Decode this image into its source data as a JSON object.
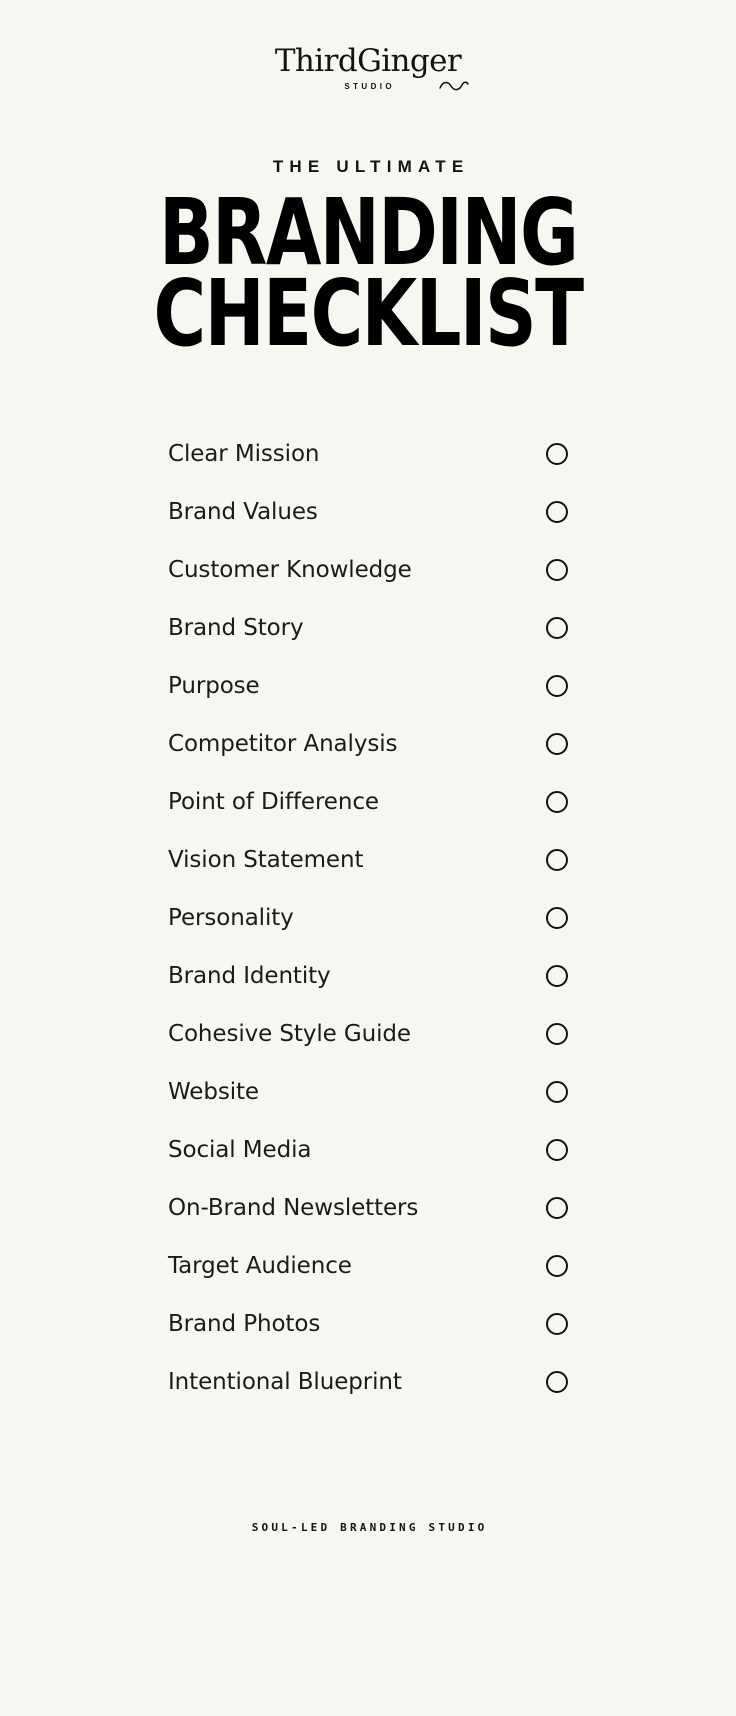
{
  "page": {
    "background_color": "#F7F6F1",
    "ink_color": "#14130F"
  },
  "brand": {
    "wordmark": "ThirdGinger",
    "subtitle": "STUDIO",
    "swash_icon": "swash-flourish-icon"
  },
  "heading": {
    "eyebrow": "THE ULTIMATE",
    "title_line_1": "BRANDING",
    "title_line_2": "CHECKLIST"
  },
  "checklist": {
    "items": [
      {
        "label": "Clear Mission",
        "checked": false
      },
      {
        "label": "Brand Values",
        "checked": false
      },
      {
        "label": "Customer Knowledge",
        "checked": false
      },
      {
        "label": "Brand Story",
        "checked": false
      },
      {
        "label": "Purpose",
        "checked": false
      },
      {
        "label": "Competitor Analysis",
        "checked": false
      },
      {
        "label": "Point of Difference",
        "checked": false
      },
      {
        "label": "Vision Statement",
        "checked": false
      },
      {
        "label": "Personality",
        "checked": false
      },
      {
        "label": "Brand Identity",
        "checked": false
      },
      {
        "label": "Cohesive Style Guide",
        "checked": false
      },
      {
        "label": "Website",
        "checked": false
      },
      {
        "label": "Social Media",
        "checked": false
      },
      {
        "label": "On-Brand Newsletters",
        "checked": false
      },
      {
        "label": "Target Audience",
        "checked": false
      },
      {
        "label": "Brand Photos",
        "checked": false
      },
      {
        "label": "Intentional Blueprint",
        "checked": false
      }
    ]
  },
  "footer": {
    "tagline": "SOUL-LED BRANDING STUDIO"
  }
}
